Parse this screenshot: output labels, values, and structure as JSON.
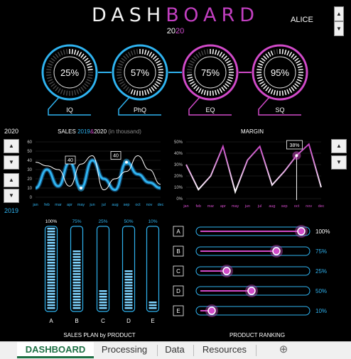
{
  "header": {
    "title_white": "DASH",
    "title_purple": "BOARD",
    "year_white": "20",
    "year_purple": "20",
    "user": "ALICE"
  },
  "gauges": [
    {
      "label": "IQ",
      "value_text": "25%",
      "value": 0.25,
      "color": "#2fb3f0"
    },
    {
      "label": "PhQ",
      "value_text": "57%",
      "value": 0.57,
      "color": "#2fb3f0"
    },
    {
      "label": "EQ",
      "value_text": "75%",
      "value": 0.75,
      "color": "#d14ac9"
    },
    {
      "label": "SQ",
      "value_text": "95%",
      "value": 0.95,
      "color": "#d14ac9"
    }
  ],
  "left_panel": {
    "year_top": "2020",
    "year_bottom": "2019"
  },
  "sales_chart": {
    "title_prefix": "SALES ",
    "title_2019": "2019",
    "title_amp": "&",
    "title_2020": "2020",
    "title_suffix": " (in thousand)",
    "callout_a": "40",
    "callout_b": "40"
  },
  "margin_chart": {
    "title": "MARGIN",
    "callout": "38%"
  },
  "sales_plan": {
    "title": "SALES PLAN by PRODUCT"
  },
  "ranking": {
    "title": "PRODUCT RANKING"
  },
  "chart_data": [
    {
      "type": "line",
      "title": "SALES 2019&2020 (in thousand)",
      "categories": [
        "jan",
        "feb",
        "mar",
        "apr",
        "may",
        "jun",
        "jul",
        "aug",
        "sep",
        "oct",
        "nov",
        "dec"
      ],
      "ylim": [
        0,
        60
      ],
      "yticks": [
        "0",
        "10",
        "20",
        "30",
        "40",
        "50",
        "60"
      ],
      "series": [
        {
          "name": "2019",
          "values": [
            10,
            30,
            12,
            38,
            10,
            40,
            20,
            8,
            38,
            25,
            16,
            10
          ]
        },
        {
          "name": "2020",
          "values": [
            38,
            34,
            30,
            12,
            36,
            45,
            8,
            20,
            28,
            45,
            30,
            14
          ]
        }
      ]
    },
    {
      "type": "line",
      "title": "MARGIN",
      "categories": [
        "jan",
        "feb",
        "mar",
        "apr",
        "may",
        "jun",
        "jul",
        "aug",
        "sep",
        "oct",
        "nov",
        "dec"
      ],
      "ylim": [
        0,
        50
      ],
      "yticks": [
        "0%",
        "10%",
        "20%",
        "30%",
        "40%",
        "50%"
      ],
      "series": [
        {
          "values": [
            30,
            8,
            20,
            46,
            6,
            34,
            46,
            12,
            24,
            38,
            48,
            10
          ]
        }
      ]
    },
    {
      "type": "bar",
      "title": "SALES PLAN by PRODUCT",
      "categories": [
        "A",
        "B",
        "C",
        "D",
        "E"
      ],
      "values": [
        100,
        75,
        25,
        50,
        10
      ],
      "value_labels": [
        "100%",
        "75%",
        "25%",
        "50%",
        "10%"
      ]
    },
    {
      "type": "bar",
      "title": "PRODUCT RANKING",
      "categories": [
        "A",
        "B",
        "C",
        "D",
        "E"
      ],
      "values": [
        100,
        75,
        25,
        50,
        10
      ],
      "value_labels": [
        "100%",
        "75%",
        "25%",
        "50%",
        "10%"
      ]
    }
  ],
  "tabs": [
    "DASHBOARD",
    "Processing",
    "Data",
    "Resources"
  ],
  "add_sheet_icon": "plus-circle-icon"
}
